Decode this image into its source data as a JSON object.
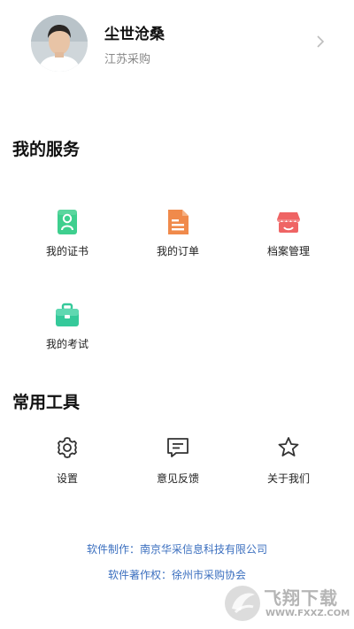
{
  "profile": {
    "name": "尘世沧桑",
    "org": "江苏采购"
  },
  "services": {
    "title": "我的服务",
    "items": [
      {
        "label": "我的证书",
        "icon": "certificate-icon",
        "color": "#3ecf8e"
      },
      {
        "label": "我的订单",
        "icon": "order-document-icon",
        "color": "#f08a4b"
      },
      {
        "label": "档案管理",
        "icon": "store-awning-icon",
        "color": "#ef6464"
      },
      {
        "label": "我的考试",
        "icon": "briefcase-icon",
        "color": "#35c99a"
      }
    ]
  },
  "tools": {
    "title": "常用工具",
    "items": [
      {
        "label": "设置",
        "icon": "gear-icon"
      },
      {
        "label": "意见反馈",
        "icon": "feedback-message-icon"
      },
      {
        "label": "关于我们",
        "icon": "star-icon"
      }
    ]
  },
  "footer": {
    "maker": "软件制作：南京华采信息科技有限公司",
    "copyright": "软件著作权：徐州市采购协会"
  },
  "watermark": {
    "text": "飞翔下载",
    "url": "WWW.FXXZ.COM"
  },
  "colors": {
    "accent_text": "#3b6fbf",
    "green": "#3ecf8e",
    "orange": "#f08a4b",
    "red": "#ef6464",
    "teal": "#35c99a"
  }
}
